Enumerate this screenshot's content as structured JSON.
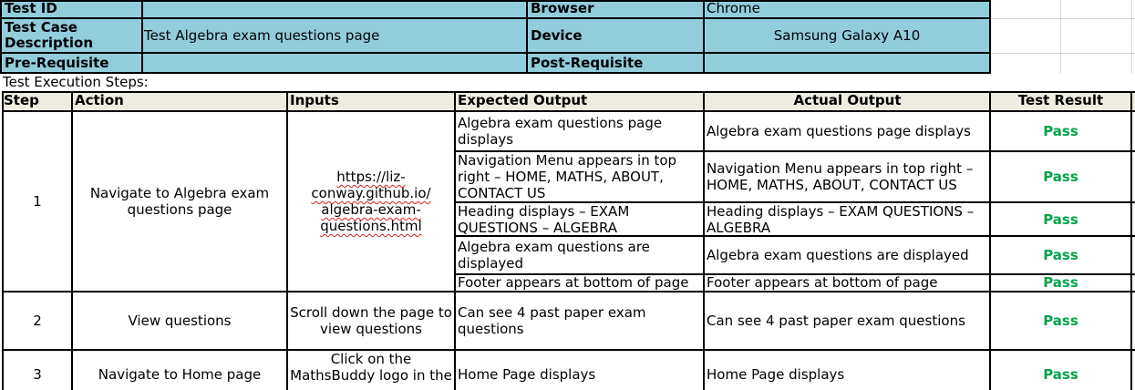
{
  "header": {
    "test_id_label": "Test  ID",
    "test_id_value": "",
    "browser_label": "Browser",
    "browser_value": "Chrome",
    "description_label_line1": "Test Case",
    "description_label_line2": "Description",
    "description_value": "Test Algebra exam questions page",
    "device_label": "Device",
    "device_value": "Samsung Galaxy A10",
    "prereq_label": "Pre-Requisite",
    "prereq_value": "",
    "postreq_label": "Post-Requisite",
    "postreq_value": ""
  },
  "section_title": "Test Execution Steps:",
  "columns": {
    "step": "Step",
    "action": "Action",
    "inputs": "Inputs",
    "expected": "Expected Output",
    "actual": "Actual Output",
    "result": "Test Result"
  },
  "steps": [
    {
      "step": "1",
      "action": "Navigate to Algebra exam questions page",
      "input_lines": [
        "https://liz-",
        "conway.github.io/",
        "algebra-exam-",
        "questions.html"
      ],
      "checks": [
        {
          "expected": "Algebra exam questions page displays",
          "actual": "Algebra exam questions page displays",
          "result": "Pass"
        },
        {
          "expected": "Navigation Menu appears in top right – HOME, MATHS, ABOUT, CONTACT US",
          "actual": "Navigation Menu appears in top right – HOME, MATHS, ABOUT, CONTACT US",
          "result": "Pass"
        },
        {
          "expected": "Heading displays – EXAM QUESTIONS – ALGEBRA",
          "actual": "Heading displays – EXAM QUESTIONS – ALGEBRA",
          "result": "Pass"
        },
        {
          "expected": "Algebra exam questions are displayed",
          "actual": "Algebra exam questions are displayed",
          "result": "Pass"
        },
        {
          "expected": "Footer appears at bottom of page",
          "actual": "Footer appears at bottom of page",
          "result": "Pass"
        }
      ]
    },
    {
      "step": "2",
      "action": "View questions",
      "inputs": "Scroll down the page to view questions",
      "checks": [
        {
          "expected": "Can see 4 past paper exam questions",
          "actual": "Can see 4 past paper exam questions",
          "result": "Pass"
        }
      ]
    },
    {
      "step": "3",
      "action": "Navigate to Home page",
      "input_lines": [
        "Click on the",
        "MathsBuddy logo in the"
      ],
      "checks": [
        {
          "expected": "Home Page displays",
          "actual": "Home Page displays",
          "result": "Pass"
        }
      ]
    }
  ]
}
